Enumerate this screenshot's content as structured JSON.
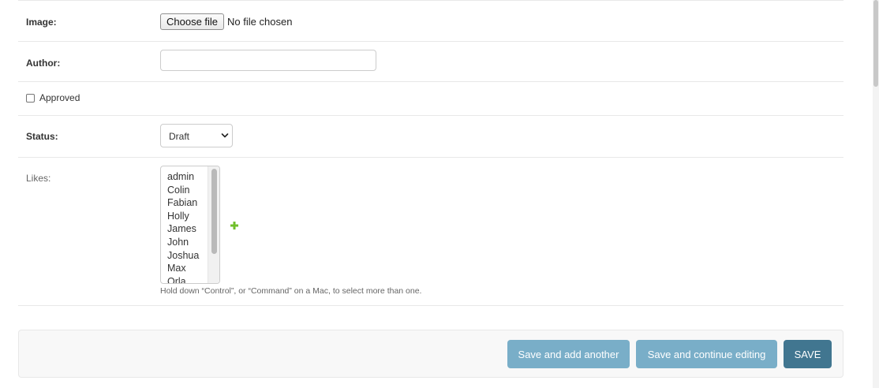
{
  "form": {
    "image": {
      "label": "Image:",
      "button": "Choose file",
      "status": "No file chosen"
    },
    "author": {
      "label": "Author:",
      "value": ""
    },
    "approved": {
      "label": "Approved",
      "checked": false
    },
    "status": {
      "label": "Status:",
      "selected": "Draft"
    },
    "likes": {
      "label": "Likes:",
      "options": [
        "admin",
        "Colin",
        "Fabian",
        "Holly",
        "James",
        "John",
        "Joshua",
        "Max",
        "Orla"
      ],
      "help": "Hold down “Control”, or “Command” on a Mac, to select more than one."
    }
  },
  "submit": {
    "save_add_another": "Save and add another",
    "save_continue": "Save and continue editing",
    "save": "SAVE"
  },
  "colors": {
    "primary_button": "#79aec8",
    "default_button": "#417690",
    "add_icon": "#70bf2b"
  },
  "icons": {
    "add_related": "plus-icon",
    "select_arrow": "chevron-down-icon"
  }
}
